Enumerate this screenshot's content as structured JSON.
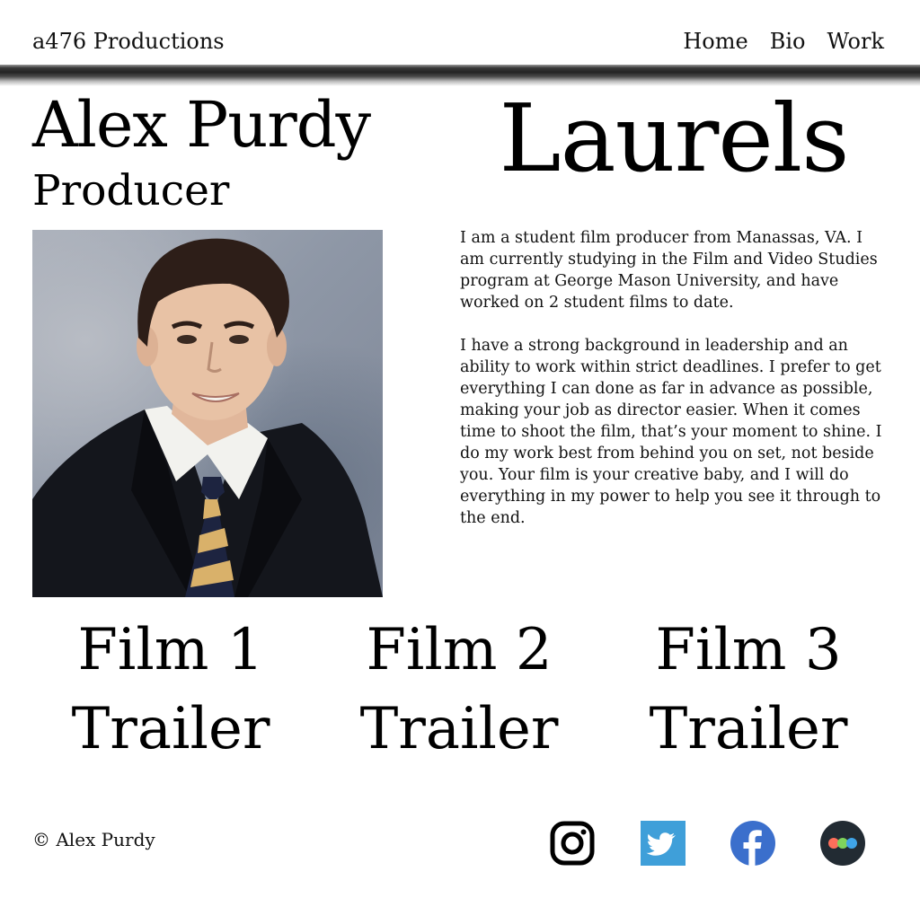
{
  "header": {
    "brand": "a476 Productions",
    "nav": [
      "Home",
      "Bio",
      "Work"
    ]
  },
  "profile": {
    "name": "Alex Purdy",
    "role": "Producer",
    "photo_alt": "Headshot of Alex Purdy"
  },
  "laurels": {
    "heading": "Laurels"
  },
  "bio": {
    "paragraphs": [
      "I am a student film producer from Manassas, VA. I am currently studying in the Film and Video Studies program at George Mason University, and have worked on 2 student films to date.",
      "I have a strong background in leadership and an ability to work within strict deadlines. I prefer to get everything I can done as far in advance as possible, making your job as director easier. When it comes time to shoot the film, that’s your moment to shine. I do my work best from behind you on set, not beside you. Your film is your creative baby, and I will do everything in my power to help you see it through to the end."
    ]
  },
  "trailers": [
    {
      "line1": "Film 1",
      "line2": "Trailer"
    },
    {
      "line1": "Film 2",
      "line2": "Trailer"
    },
    {
      "line1": "Film 3",
      "line2": "Trailer"
    }
  ],
  "footer": {
    "copyright": "© Alex Purdy",
    "social": [
      {
        "icon": "instagram-icon",
        "color": "#000000"
      },
      {
        "icon": "twitter-icon",
        "color": "#3f9fd9"
      },
      {
        "icon": "facebook-icon",
        "color": "#3b6fcc"
      },
      {
        "icon": "flickr-icon",
        "color": "#222b33"
      }
    ]
  }
}
